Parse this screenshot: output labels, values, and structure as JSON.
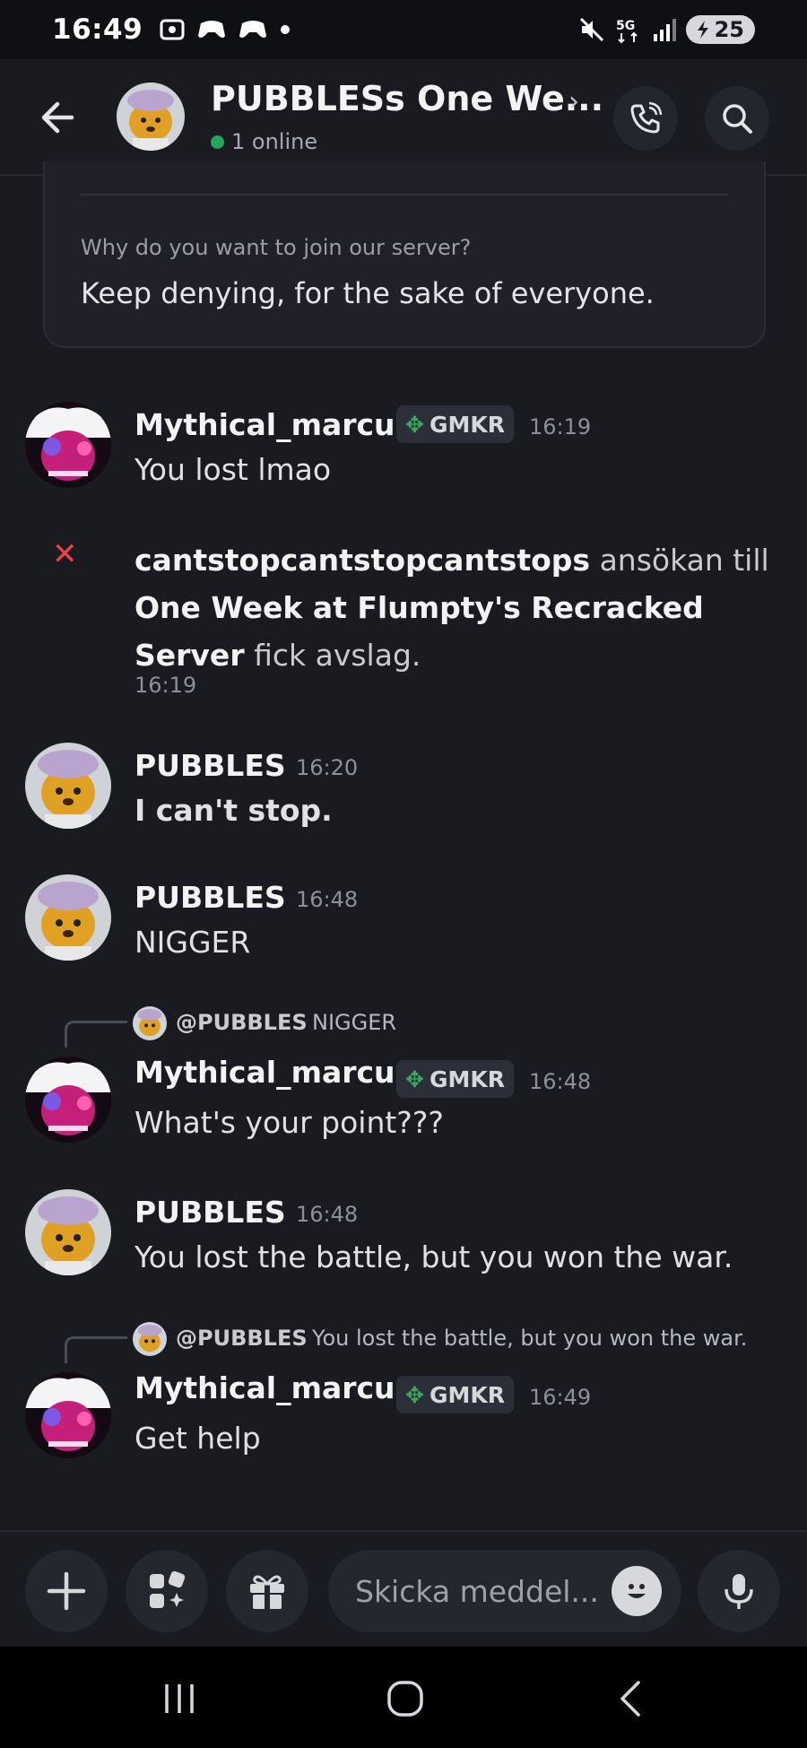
{
  "status_bar": {
    "time": "16:49",
    "battery": "25",
    "icons_left": [
      "screenshot-icon",
      "gamepad-icon",
      "gamepad-icon",
      "dot-icon"
    ],
    "icons_right": [
      "mute-icon",
      "5g-icon",
      "signal-icon",
      "battery-icon"
    ]
  },
  "header": {
    "title": "PUBBLESs One We...",
    "online_text": "1 online"
  },
  "application_card": {
    "question": "Why do you want to join our server?",
    "answer": "Keep denying, for the sake of everyone."
  },
  "messages": [
    {
      "author": "Mythical_marcus",
      "tag": "GMKR",
      "time": "16:19",
      "text": "You lost lmao"
    },
    {
      "system": true,
      "user": "cantstopcantstopcantstops",
      "mid": " ansökan till ",
      "server": "One Week at Flumpty's Recracked Server",
      "end": " fick avslag.",
      "time": "16:19"
    },
    {
      "author": "PUBBLES",
      "time": "16:20",
      "text": "I can't stop."
    },
    {
      "author": "PUBBLES",
      "time": "16:48",
      "text": "NIGGER"
    },
    {
      "reply_to": "@PUBBLES",
      "reply_text": "NIGGER",
      "author": "Mythical_marcus",
      "tag": "GMKR",
      "time": "16:48",
      "text": "What's your point???"
    },
    {
      "author": "PUBBLES",
      "time": "16:48",
      "text": "You lost the battle, but you won the war."
    },
    {
      "reply_to": "@PUBBLES",
      "reply_text": "You lost the battle, but you won the war.",
      "author": "Mythical_marcus",
      "tag": "GMKR",
      "time": "16:49",
      "text": "Get help"
    }
  ],
  "composer": {
    "placeholder": "Skicka meddel..."
  },
  "colors": {
    "background": "#1a1b21",
    "online": "#23a55a",
    "denied": "#ed4245"
  }
}
